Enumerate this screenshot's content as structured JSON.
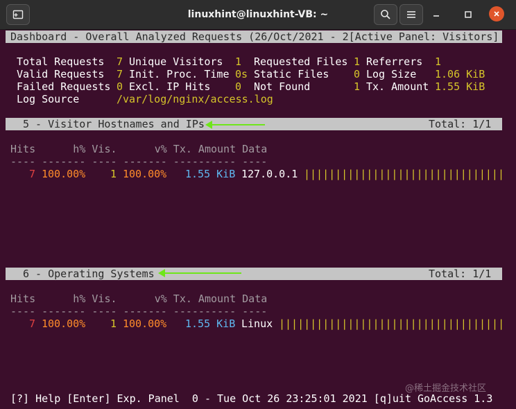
{
  "window": {
    "title": "linuxhint@linuxhint-VB: ~",
    "icons": [
      "new-tab-icon",
      "search-icon",
      "menu-icon",
      "minimize-icon",
      "maximize-icon",
      "close-icon"
    ]
  },
  "dashboard": {
    "header": "Dashboard - Overall Analyzed Requests (26/Oct/2021 - 2[Active Panel: Visitors]"
  },
  "stats": {
    "total_requests_label": "Total Requests",
    "total_requests": "7",
    "unique_visitors_label": "Unique Visitors",
    "unique_visitors": "1",
    "requested_files_label": "Requested Files",
    "requested_files": "1",
    "referrers_label": "Referrers",
    "referrers": "1",
    "valid_requests_label": "Valid Requests",
    "valid_requests": "7",
    "init_proc_time_label": "Init. Proc. Time",
    "init_proc_time": "0s",
    "static_files_label": "Static Files",
    "static_files": "0",
    "log_size_label": "Log Size",
    "log_size": "1.06 KiB",
    "failed_requests_label": "Failed Requests",
    "failed_requests": "0",
    "excl_ip_hits_label": "Excl. IP Hits",
    "excl_ip_hits": "0",
    "not_found_label": "Not Found",
    "not_found": "1",
    "tx_amount_label": "Tx. Amount",
    "tx_amount": "1.55 KiB",
    "log_source_label": "Log Source",
    "log_source": "/var/log/nginx/access.log"
  },
  "panels": [
    {
      "title": "5 - Visitor Hostnames and IPs",
      "total": "Total: 1/1",
      "columns": "Hits      h% Vis.      v% Tx. Amount Data",
      "separator": "---- ------- ---- ------- ---------- ----",
      "row": {
        "hits": "7",
        "hits_pct": "100.00%",
        "visitors": "1",
        "visitors_pct": "100.00%",
        "tx": "1.55 KiB",
        "data": "127.0.0.1",
        "bar": "||||||||||||||||||||||||||||||||||||||||"
      }
    },
    {
      "title": "6 - Operating Systems",
      "total": "Total: 1/1",
      "columns": "Hits      h% Vis.      v% Tx. Amount Data",
      "separator": "---- ------- ---- ------- ---------- ----",
      "row": {
        "hits": "7",
        "hits_pct": "100.00%",
        "visitors": "1",
        "visitors_pct": "100.00%",
        "tx": "1.55 KiB",
        "data": "Linux",
        "bar": "||||||||||||||||||||||||||||||||||||||||"
      }
    }
  ],
  "footer": {
    "help": "[?] Help [Enter] Exp. Panel  0 - Tue Oct 26 23:25:01 2021 [q]uit GoAccess 1.3",
    "watermark": "@稀土掘金技术社区"
  },
  "colors": {
    "terminal_bg": "#3b0e2b",
    "titlebar_bg": "#2d2d2d",
    "header_bar": "#c5c5c5",
    "value_yellow": "#d6c52a",
    "hits_red": "#e04141",
    "percent_orange": "#ff8c2a",
    "tx_blue": "#5fb8f0",
    "arrow_green": "#6fe61a",
    "close_button": "#e0562b"
  }
}
